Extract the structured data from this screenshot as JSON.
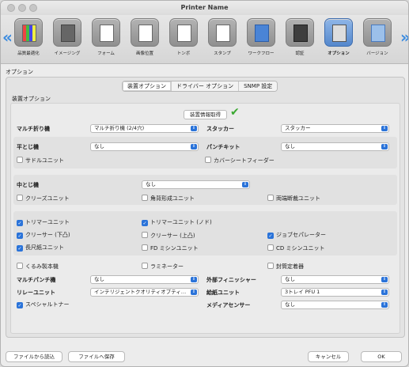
{
  "window": {
    "title": "Printer Name"
  },
  "toolbar": {
    "items": [
      {
        "label": "品質最適化",
        "icon": "quality-icon"
      },
      {
        "label": "イメージング",
        "icon": "imaging-icon"
      },
      {
        "label": "フォーム",
        "icon": "form-icon"
      },
      {
        "label": "画像位置",
        "icon": "image-position-icon"
      },
      {
        "label": "トンボ",
        "icon": "crop-marks-icon"
      },
      {
        "label": "スタンプ",
        "icon": "stamp-icon"
      },
      {
        "label": "ワークフロー",
        "icon": "workflow-icon"
      },
      {
        "label": "認証",
        "icon": "authentication-icon"
      },
      {
        "label": "オプション",
        "icon": "options-icon"
      },
      {
        "label": "バージョン",
        "icon": "version-icon"
      }
    ]
  },
  "section": {
    "title": "オプション"
  },
  "tabs": [
    "装置オプション",
    "ドライバー オプション",
    "SNMP 設定"
  ],
  "group": {
    "label": "装置オプション"
  },
  "fetch_button": "装置情報取得",
  "fields": {
    "multi_fold": {
      "label": "マルチ折り機",
      "value": "マルチ折り機 (2/4穴)"
    },
    "stacker": {
      "label": "スタッカー",
      "value": "スタッカー"
    },
    "flat_stitch": {
      "label": "平とじ機",
      "value": "なし"
    },
    "punch_kit": {
      "label": "パンチキット",
      "value": "なし"
    },
    "saddle_unit": "サドルユニット",
    "cover_sheet_feeder": "カバーシートフィーダー",
    "center_stitch": {
      "label": "中とじ機",
      "value": "なし"
    },
    "crease_unit": "クリーズユニット",
    "square_fold_unit": "角背形成ユニット",
    "double_cut_unit": "両端断裁ユニット",
    "trimmer_unit": "トリマーユニット",
    "trimmer_unit_nodo": "トリマーユニット (ノド)",
    "creaser_lower": "クリーサー (下凸)",
    "creaser_upper": "クリーサー (上凸)",
    "jog_separator": "ジョブセパレーター",
    "long_paper_unit": "長尺紙ユニット",
    "fd_sewing_unit": "FD ミシンユニット",
    "cd_sewing_unit": "CD ミシンユニット",
    "perfect_binder": "くるみ製本機",
    "laminator": "ラミネーター",
    "envelope_attach": "封筒定着器",
    "multi_punch": {
      "label": "マルチパンチ機",
      "value": "なし"
    },
    "external_finisher": {
      "label": "外部フィニッシャー",
      "value": "なし"
    },
    "relay_unit": {
      "label": "リレーユニット",
      "value": "インテリジェントクオリティオプティ…"
    },
    "paper_feed_unit": {
      "label": "給紙ユニット",
      "value": "3トレイ PFU 1"
    },
    "special_toner": "スペシャルトナー",
    "media_sensor": {
      "label": "メディアセンサー",
      "value": "なし"
    }
  },
  "checked": {
    "saddle_unit": false,
    "cover_sheet_feeder": false,
    "crease_unit": false,
    "square_fold_unit": false,
    "double_cut_unit": false,
    "trimmer_unit": true,
    "trimmer_unit_nodo": true,
    "creaser_lower": true,
    "creaser_upper": false,
    "jog_separator": true,
    "long_paper_unit": true,
    "fd_sewing_unit": false,
    "cd_sewing_unit": false,
    "perfect_binder": false,
    "laminator": false,
    "envelope_attach": false,
    "special_toner": true
  },
  "bottom": {
    "load_file": "ファイルから読込",
    "save_file": "ファイルへ保存",
    "cancel": "キャンセル",
    "ok": "OK"
  },
  "colors": {
    "accent": "#2a73d9",
    "success": "#3aa830"
  }
}
